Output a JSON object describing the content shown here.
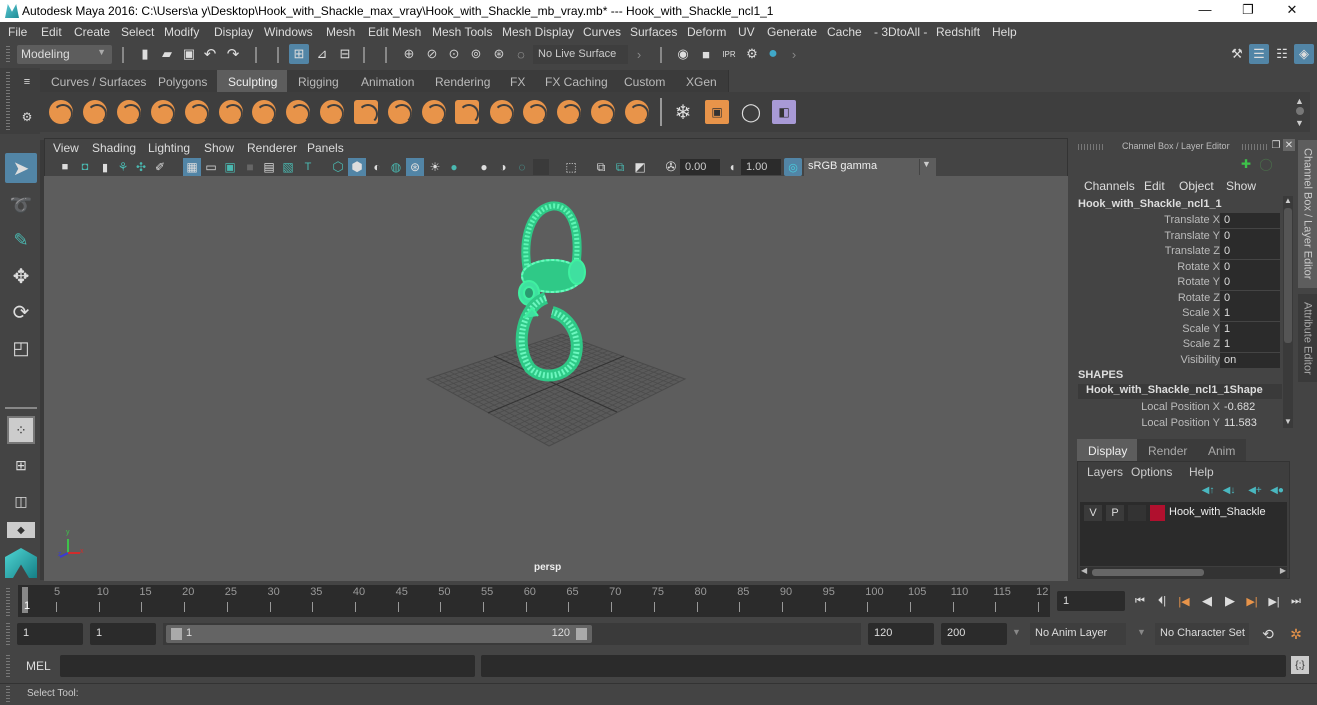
{
  "window": {
    "title": "Autodesk Maya 2016: C:\\Users\\a y\\Desktop\\Hook_with_Shackle_max_vray\\Hook_with_Shackle_mb_vray.mb*   ---   Hook_with_Shackle_ncl1_1",
    "minimize": "—",
    "maximize": "❐",
    "close": "✕"
  },
  "menubar": [
    "File",
    "Edit",
    "Create",
    "Select",
    "Modify",
    "Display",
    "Windows",
    "Mesh",
    "Edit Mesh",
    "Mesh Tools",
    "Mesh Display",
    "Curves",
    "Surfaces",
    "Deform",
    "UV",
    "Generate",
    "Cache",
    "- 3DtoAll -",
    "Redshift",
    "Help"
  ],
  "statusline": {
    "mode": "Modeling",
    "live_surface": "No Live Surface"
  },
  "shelf": {
    "tabs": [
      "Curves / Surfaces",
      "Polygons",
      "Sculpting",
      "Rigging",
      "Animation",
      "Rendering",
      "FX",
      "FX Caching",
      "Custom",
      "XGen"
    ],
    "active_tab": "Sculpting",
    "tools": [
      "sculpt",
      "smooth",
      "relax",
      "grab",
      "pinch",
      "flatten",
      "foamy",
      "spray",
      "repeat",
      "imprint",
      "wax",
      "scrape",
      "fill",
      "knife",
      "smear",
      "bulge",
      "amplify",
      "freeze",
      "convert-to-frozen",
      "sculpt-settings",
      "mesh-stamp",
      "stamp-editor"
    ]
  },
  "viewport": {
    "menu": [
      "View",
      "Shading",
      "Lighting",
      "Show",
      "Renderer",
      "Panels"
    ],
    "exposure": "0.00",
    "gamma": "1.00",
    "color_space": "sRGB gamma",
    "camera_label": "persp",
    "axis": {
      "x": "x",
      "y": "y",
      "z": "z"
    },
    "wire_color": "#3ff0a0"
  },
  "channel_box": {
    "title": "Channel Box / Layer Editor",
    "menu": [
      "Channels",
      "Edit",
      "Object",
      "Show"
    ],
    "object_name": "Hook_with_Shackle_ncl1_1",
    "channels": [
      {
        "label": "Translate X",
        "value": "0"
      },
      {
        "label": "Translate Y",
        "value": "0"
      },
      {
        "label": "Translate Z",
        "value": "0"
      },
      {
        "label": "Rotate X",
        "value": "0"
      },
      {
        "label": "Rotate Y",
        "value": "0"
      },
      {
        "label": "Rotate Z",
        "value": "0"
      },
      {
        "label": "Scale X",
        "value": "1"
      },
      {
        "label": "Scale Y",
        "value": "1"
      },
      {
        "label": "Scale Z",
        "value": "1"
      },
      {
        "label": "Visibility",
        "value": "on"
      }
    ],
    "shapes_header": "SHAPES",
    "shape_name": "Hook_with_Shackle_ncl1_1Shape",
    "shape_channels": [
      {
        "label": "Local Position X",
        "value": "-0.682"
      },
      {
        "label": "Local Position Y",
        "value": "11.583"
      }
    ]
  },
  "side_tabs": [
    "Channel Box / Layer Editor",
    "Attribute Editor"
  ],
  "layer_editor": {
    "tabs": [
      "Display",
      "Render",
      "Anim"
    ],
    "active_tab": "Display",
    "menu": [
      "Layers",
      "Options",
      "Help"
    ],
    "layers": [
      {
        "v": "V",
        "p": "P",
        "color": "#b0102e",
        "name": "Hook_with_Shackle"
      }
    ]
  },
  "timeline": {
    "ticks": [
      5,
      10,
      15,
      20,
      25,
      30,
      35,
      40,
      45,
      50,
      55,
      60,
      65,
      70,
      75,
      80,
      85,
      90,
      95,
      100,
      105,
      110,
      115,
      "12"
    ],
    "current_frame_marker": "1",
    "current_frame": "1"
  },
  "range": {
    "start_time": "1",
    "playback_start": "1",
    "slider_start": "1",
    "slider_end": "120",
    "playback_end": "120",
    "end_time": "200",
    "anim_layer": "No Anim Layer",
    "character_set": "No Character Set"
  },
  "command_line": {
    "label": "MEL"
  },
  "help_line": "Select Tool:",
  "colors": {
    "accent_orange": "#e8944a",
    "selection_blue": "#5285a6"
  }
}
